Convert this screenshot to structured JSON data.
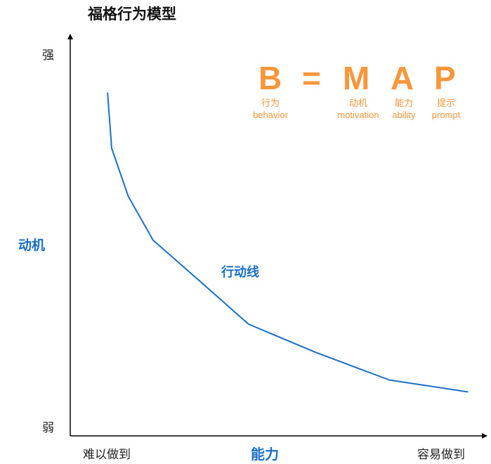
{
  "title": "福格行为模型",
  "y_axis": {
    "title": "动机",
    "top_label": "强",
    "bottom_label": "弱"
  },
  "x_axis": {
    "title": "能力",
    "left_label": "难以做到",
    "right_label": "容易做到"
  },
  "curve_label": "行动线",
  "formula": {
    "equals": "=",
    "terms": [
      {
        "letter": "B",
        "zh": "行为",
        "en": "behavior"
      },
      {
        "letter": "M",
        "zh": "动机",
        "en": "motivation"
      },
      {
        "letter": "A",
        "zh": "能力",
        "en": "ability"
      },
      {
        "letter": "P",
        "zh": "提示",
        "en": "prompt"
      }
    ]
  },
  "colors": {
    "accent_blue": "#1a6fc8",
    "formula_orange": "#f7963a",
    "axis": "#000000"
  },
  "chart_data": {
    "type": "line",
    "title": "福格行为模型",
    "xlabel": "能力",
    "ylabel": "动机",
    "x_tick_labels": [
      "难以做到",
      "容易做到"
    ],
    "y_tick_labels": [
      "弱",
      "强"
    ],
    "xlim": [
      0,
      1
    ],
    "ylim": [
      0,
      1
    ],
    "grid": false,
    "series": [
      {
        "name": "行动线",
        "x": [
          0.09,
          0.1,
          0.14,
          0.2,
          0.31,
          0.43,
          0.59,
          0.77,
          0.96
        ],
        "y": [
          0.86,
          0.72,
          0.6,
          0.49,
          0.39,
          0.28,
          0.21,
          0.14,
          0.11
        ]
      }
    ]
  }
}
